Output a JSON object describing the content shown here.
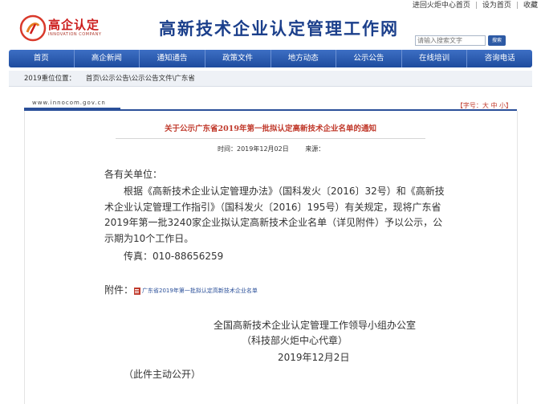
{
  "top_links": [
    "进回火炬中心首页",
    "设为首页",
    "收藏"
  ],
  "logo": {
    "cn": "高企认定",
    "en": "INNOVATION COMPANY"
  },
  "site_title": "高新技术企业认定管理工作网",
  "search": {
    "placeholder": "请输入搜索文字",
    "button": "搜索"
  },
  "nav": [
    "首页",
    "高企新闻",
    "通知通告",
    "政策文件",
    "地方动态",
    "公示公告",
    "在线培训",
    "咨询电话"
  ],
  "breadcrumb": {
    "label": "2019重位位置：",
    "path": "首页\\公示公告\\公示公告文件\\广东省"
  },
  "url_text": "www.innocom.gov.cn",
  "font_size_label": "【字号：大 中 小】",
  "article": {
    "title": "关于公示广东省2019年第一批拟认定高新技术企业名单的通知",
    "time_label": "时间：2019年12月02日",
    "source_label": "来源：",
    "greeting": "各有关单位：",
    "paragraph": "根据《高新技术企业认定管理办法》（国科发火〔2016〕32号）和《高新技术企业认定管理工作指引》（国科发火〔2016〕195号）有关规定，现将广东省2019年第一批3240家企业拟认定高新技术企业名单（详见附件）予以公示，公示期为10个工作日。",
    "fax": "传真：010-88656259",
    "attachment_label": "附件：",
    "attachment_link": "广东省2019年第一批拟认定高新技术企业名单",
    "signature_org": "全国高新技术企业认定管理工作领导小组办公室",
    "signature_sub": "（科技部火炬中心代章）",
    "signature_date": "2019年12月2日",
    "note": "（此件主动公开）"
  }
}
